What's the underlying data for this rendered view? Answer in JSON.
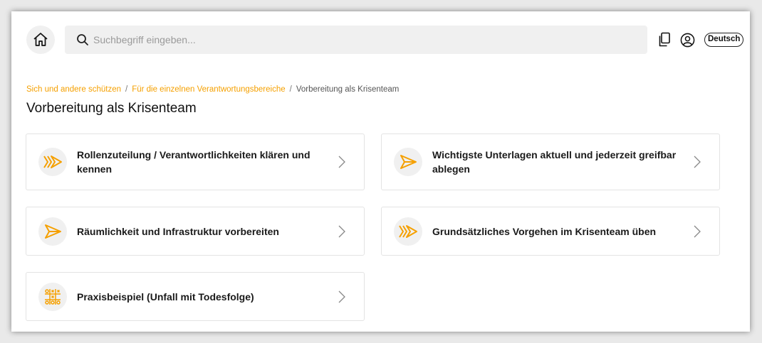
{
  "header": {
    "search_placeholder": "Suchbegriff eingeben...",
    "language_label": "Deutsch"
  },
  "breadcrumb": {
    "items": [
      "Sich und andere schützen",
      "Für die einzelnen Verantwortungsbereiche"
    ],
    "current": "Vorbereitung als Krisenteam"
  },
  "page_title": "Vorbereitung als Krisenteam",
  "cards": [
    {
      "label": "Rollenzuteilung / Verantwortlichkeiten klären und kennen",
      "icon": "double-chevron-icon"
    },
    {
      "label": "Wichtigste Unterlagen aktuell und jederzeit greifbar ablegen",
      "icon": "paper-plane-icon"
    },
    {
      "label": "Räumlichkeit und Infrastruktur vorbereiten",
      "icon": "paper-plane-icon"
    },
    {
      "label": "Grundsätzliches Vorgehen im Krisenteam üben",
      "icon": "double-chevron-icon"
    },
    {
      "label": "Praxisbeispiel (Unfall mit Todesfolge)",
      "icon": "tic-tac-toe-icon"
    }
  ],
  "colors": {
    "accent": "#f5a000",
    "icon_bg": "#f0f0f0"
  }
}
